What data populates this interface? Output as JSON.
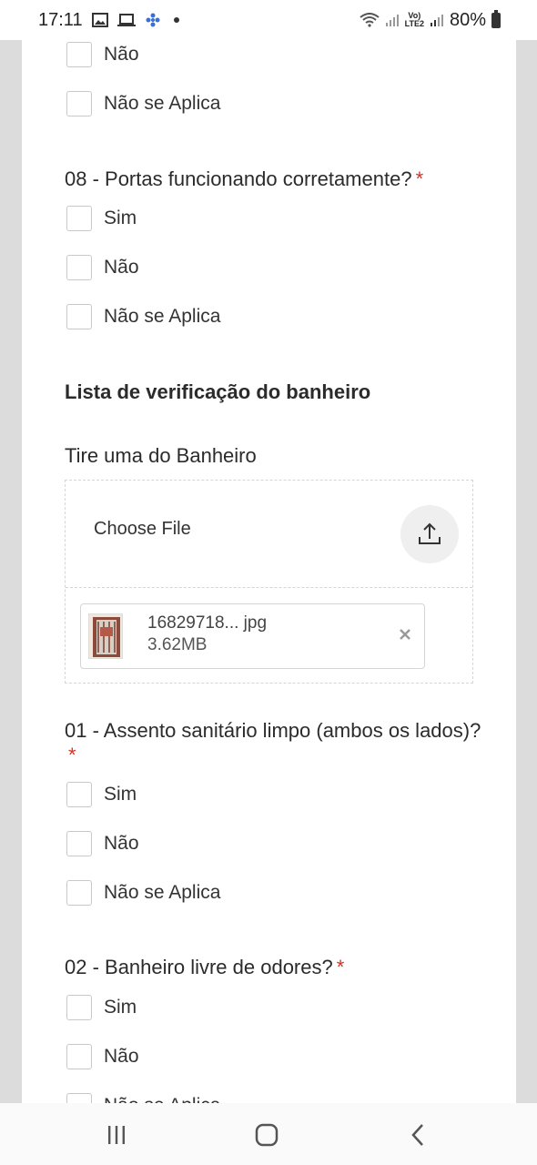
{
  "status_bar": {
    "time": "17:11",
    "left_icons": [
      "image-icon",
      "laptop-icon",
      "app-icon"
    ],
    "battery": "80%"
  },
  "form": {
    "prev_question_options": [
      "Não",
      "Não se Aplica"
    ],
    "q08": {
      "label": "08 - Portas funcionando corretamente?",
      "required_mark": "*",
      "options": [
        "Sim",
        "Não",
        "Não se Aplica"
      ]
    },
    "section_title": "Lista de verificação do banheiro",
    "photo_question": {
      "label": "Tire uma do Banheiro",
      "choose_file": "Choose File",
      "file_name": "16829718... jpg",
      "file_size": "3.62MB"
    },
    "q01": {
      "label": "01 - Assento sanitário limpo (ambos os lados)?",
      "required_mark": "*",
      "options": [
        "Sim",
        "Não",
        "Não se Aplica"
      ]
    },
    "q02": {
      "label": "02 - Banheiro livre de odores?",
      "required_mark": "*",
      "options": [
        "Sim",
        "Não",
        "Não se Aplica"
      ]
    }
  },
  "colors": {
    "required": "#d93025",
    "checkbox_border": "#c9c9c9"
  }
}
